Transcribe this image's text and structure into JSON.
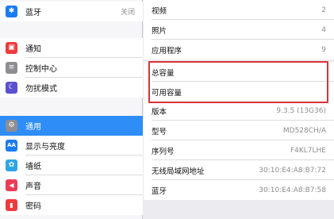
{
  "sidebar": {
    "top_items": [
      {
        "label": "蓝牙",
        "value": "关闭",
        "icon": "bluetooth-icon",
        "glyph": "✱",
        "color": "#1a7cf5"
      }
    ],
    "group2": [
      {
        "label": "通知",
        "icon": "notifications-icon",
        "glyph": "▣",
        "color": "#ee3b3b"
      },
      {
        "label": "控制中心",
        "icon": "control-center-icon",
        "glyph": "≡",
        "color": "#8e8e93"
      },
      {
        "label": "勿扰模式",
        "icon": "do-not-disturb-icon",
        "glyph": "☾",
        "color": "#5b4fcf"
      }
    ],
    "group3": [
      {
        "label": "通用",
        "icon": "general-gear-icon",
        "glyph": "⚙",
        "color": "#8e8e93",
        "selected": true
      },
      {
        "label": "显示与亮度",
        "icon": "display-brightness-icon",
        "glyph": "AA",
        "color": "#1a7cf5"
      },
      {
        "label": "墙纸",
        "icon": "wallpaper-icon",
        "glyph": "✿",
        "color": "#2aa6e8"
      },
      {
        "label": "声音",
        "icon": "sounds-icon",
        "glyph": "◀",
        "color": "#ee3b56"
      },
      {
        "label": "密码",
        "icon": "passcode-icon",
        "glyph": "▮",
        "color": "#ee3b3b"
      }
    ]
  },
  "about": {
    "group1": [
      {
        "key": "视频",
        "value": "2"
      },
      {
        "key": "照片",
        "value": "4"
      },
      {
        "key": "应用程序",
        "value": "9"
      }
    ],
    "group2": [
      {
        "key": "总容量",
        "value": ""
      },
      {
        "key": "可用容量",
        "value": ""
      }
    ],
    "group3": [
      {
        "key": "版本",
        "value": "9.3.5 (13G36)"
      },
      {
        "key": "型号",
        "value": "MD528CH/A"
      },
      {
        "key": "序列号",
        "value": "F4KL7LHE"
      },
      {
        "key": "无线局域网地址",
        "value": "30:10:E4:A8:B7:72"
      },
      {
        "key": "蓝牙",
        "value": "30:10:E4:A8:B7:58"
      }
    ]
  },
  "colors": {
    "selected_bg": "#2e8df6",
    "highlight_border": "#d9323a"
  }
}
